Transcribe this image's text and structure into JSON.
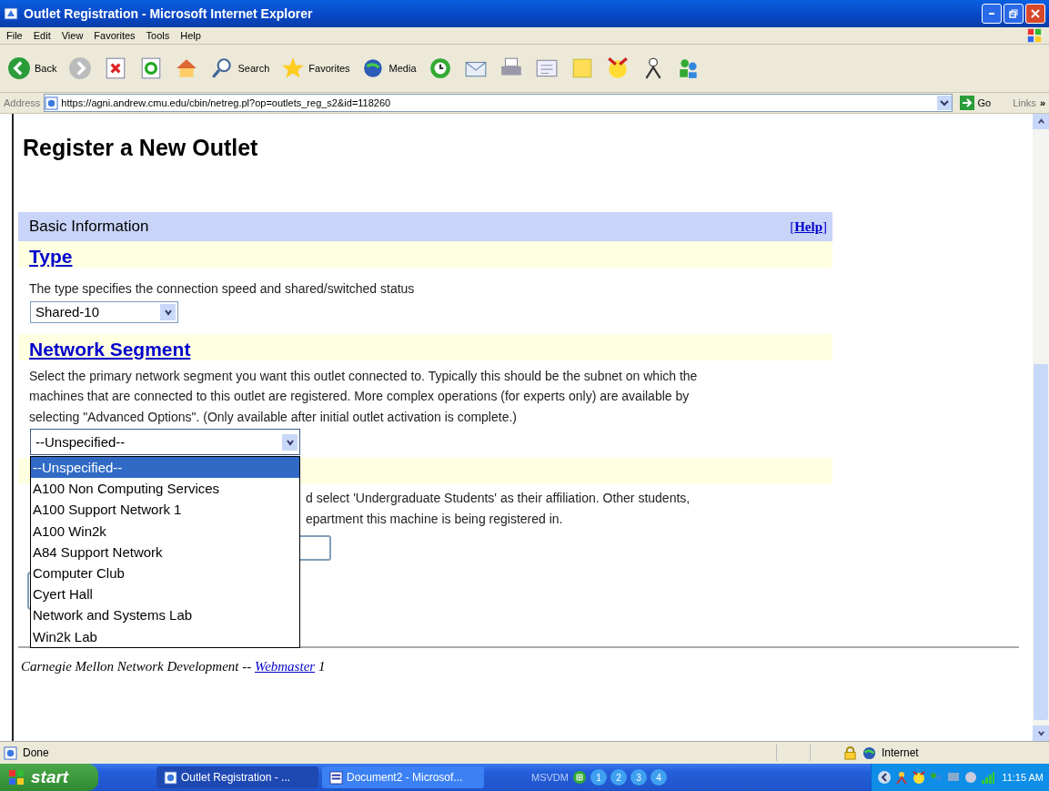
{
  "window": {
    "title": "Outlet Registration - Microsoft Internet Explorer"
  },
  "menu": [
    "File",
    "Edit",
    "View",
    "Favorites",
    "Tools",
    "Help"
  ],
  "toolbar": [
    {
      "kind": "back",
      "label": "Back"
    },
    {
      "kind": "forward"
    },
    {
      "kind": "stop"
    },
    {
      "kind": "refresh"
    },
    {
      "kind": "home"
    },
    {
      "kind": "search",
      "label": "Search"
    },
    {
      "kind": "favorites",
      "label": "Favorites"
    },
    {
      "kind": "media",
      "label": "Media"
    },
    {
      "kind": "history"
    },
    {
      "kind": "mail"
    },
    {
      "kind": "print"
    },
    {
      "kind": "edit"
    },
    {
      "kind": "note"
    },
    {
      "kind": "messenger"
    },
    {
      "kind": "person"
    },
    {
      "kind": "people"
    }
  ],
  "address": {
    "label": "Address",
    "url": "https://agni.andrew.cmu.edu/cbin/netreg.pl?op=outlets_reg_s2&id=118260",
    "go": "Go",
    "links": "Links",
    "more": "»"
  },
  "page": {
    "heading": "Register a New Outlet",
    "section": "Basic Information",
    "help_open": "[",
    "help": "Help",
    "help_close": "]",
    "type": {
      "heading": "Type",
      "description": "The type specifies the connection speed and shared/switched status",
      "value": "Shared-10"
    },
    "segment": {
      "heading": "Network Segment",
      "description": "Select the primary network segment you want this outlet connected to. Typically this should be the subnet on which the machines that are connected to this outlet are registered. More complex operations (for experts only) are available by selecting \"Advanced Options\". (Only available after initial outlet activation is complete.)",
      "value": "--Unspecified--",
      "expanded": true,
      "options": [
        {
          "label": "--Unspecified--",
          "selected": true
        },
        {
          "label": "A100 Non Computing Services",
          "selected": false
        },
        {
          "label": "A100 Support Network 1",
          "selected": false
        },
        {
          "label": "A100 Win2k",
          "selected": false
        },
        {
          "label": "A84 Support Network",
          "selected": false
        },
        {
          "label": "Computer Club",
          "selected": false
        },
        {
          "label": "Cyert Hall",
          "selected": false
        },
        {
          "label": "Network and Systems Lab",
          "selected": false
        },
        {
          "label": "Win2k Lab",
          "selected": false
        }
      ]
    },
    "hidden_lines": [
      "d select 'Undergraduate Students' as their affiliation. Other students,",
      "epartment this machine is being registered in."
    ],
    "footer": {
      "text": "Carnegie Mellon Network Development --",
      "link": "Webmaster",
      "suffix": "1"
    }
  },
  "status": {
    "text": "Done",
    "zone": "Internet"
  },
  "taskbar": {
    "start": "start",
    "tasks": [
      {
        "label": "Outlet Registration - ...",
        "kind": "ie",
        "selected": true
      },
      {
        "label": "Document2 - Microsof...",
        "kind": "word",
        "selected": false
      }
    ],
    "toolbar_label": "MSVDM",
    "desktops": [
      "1",
      "2",
      "3",
      "4"
    ],
    "clock": "11:15 AM"
  }
}
